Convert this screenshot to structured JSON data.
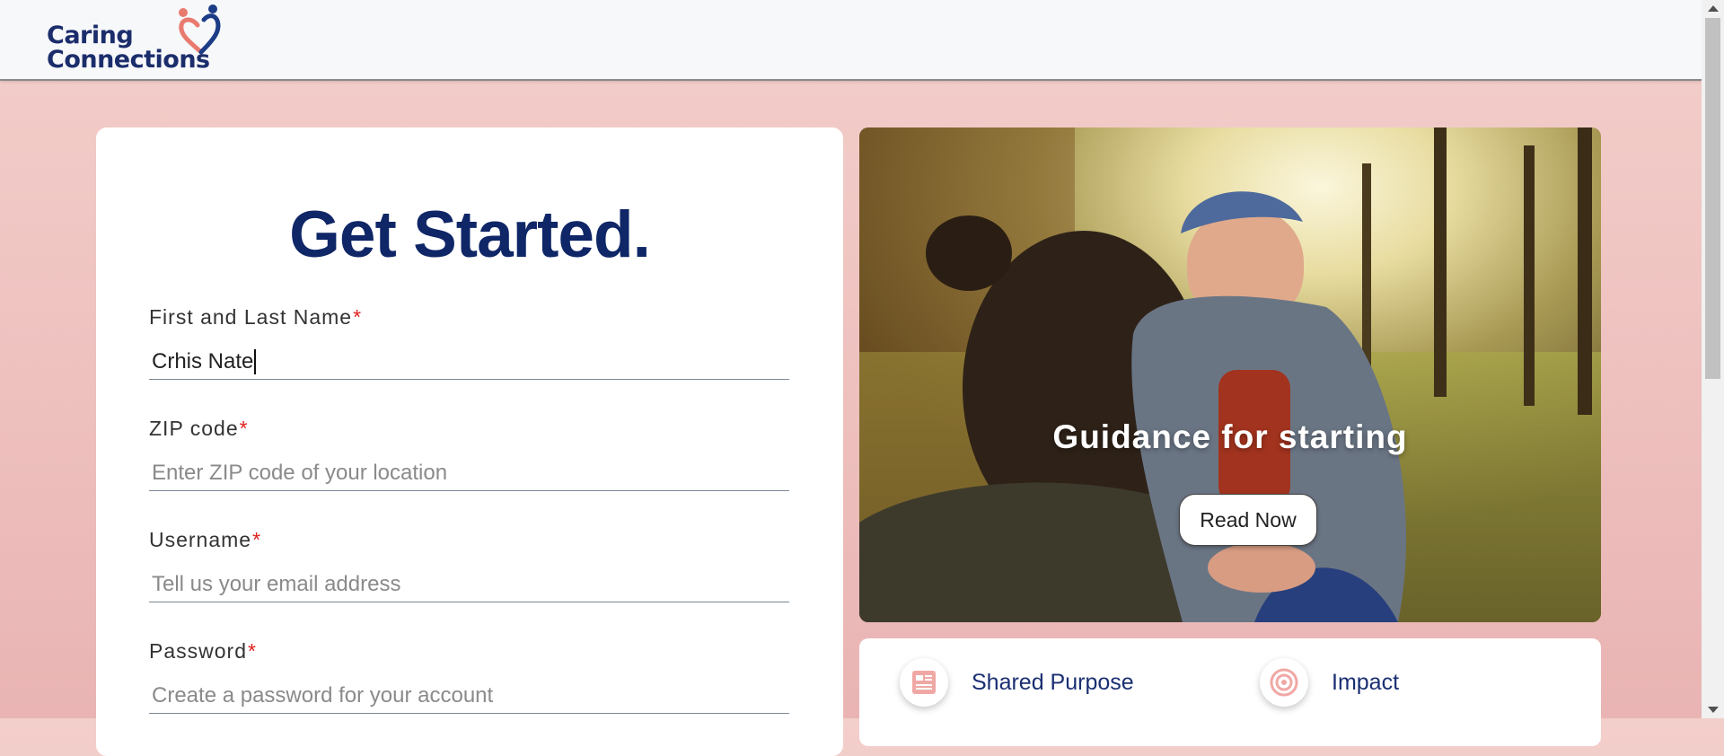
{
  "header": {
    "logo": {
      "line1": "Caring",
      "line2": "Connections",
      "icon": "heart-people-logo-icon"
    }
  },
  "form": {
    "title": "Get Started.",
    "required_mark": "*",
    "fields": {
      "name": {
        "label": "First and Last Name",
        "value": "Crhis Nate",
        "placeholder": ""
      },
      "zip": {
        "label": "ZIP code",
        "value": "",
        "placeholder": "Enter ZIP code of your location"
      },
      "username": {
        "label": "Username",
        "value": "",
        "placeholder": "Tell us your email address"
      },
      "password": {
        "label": "Password",
        "value": "",
        "placeholder": "Create a password for your account"
      }
    }
  },
  "hero": {
    "title": "Guidance for starting",
    "button_label": "Read Now"
  },
  "features": [
    {
      "label": "Shared Purpose",
      "icon": "article-icon"
    },
    {
      "label": "Impact",
      "icon": "target-icon"
    }
  ],
  "colors": {
    "brand_navy": "#0f2667",
    "required": "#e0201d",
    "background_pink": "#f3cfcb",
    "icon_pink": "#f0a8a5"
  }
}
